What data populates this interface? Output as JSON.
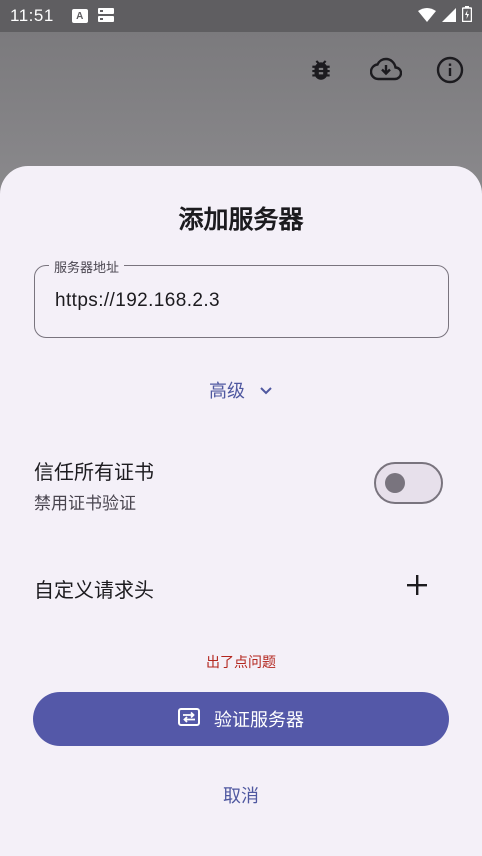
{
  "status_bar": {
    "time": "11:51",
    "icons_left": [
      "a-icon",
      "storage-icon"
    ],
    "icons_right": [
      "wifi-icon",
      "signal-icon",
      "battery-icon"
    ]
  },
  "toolbar": {
    "icons": [
      "bug-icon",
      "cloud-download-icon",
      "info-icon"
    ]
  },
  "dialog": {
    "title": "添加服务器",
    "server_field": {
      "label": "服务器地址",
      "value": "https://192.168.2.3"
    },
    "advanced_label": "高级",
    "trust_all_certs": {
      "title": "信任所有证书",
      "subtitle": "禁用证书验证",
      "enabled": false
    },
    "custom_headers_label": "自定义请求头",
    "error_text": "出了点问题",
    "verify_button_label": "验证服务器",
    "cancel_button_label": "取消"
  },
  "colors": {
    "accent": "#5458a8",
    "error": "#b3261e",
    "sheet_background": "#f4f0f8"
  }
}
